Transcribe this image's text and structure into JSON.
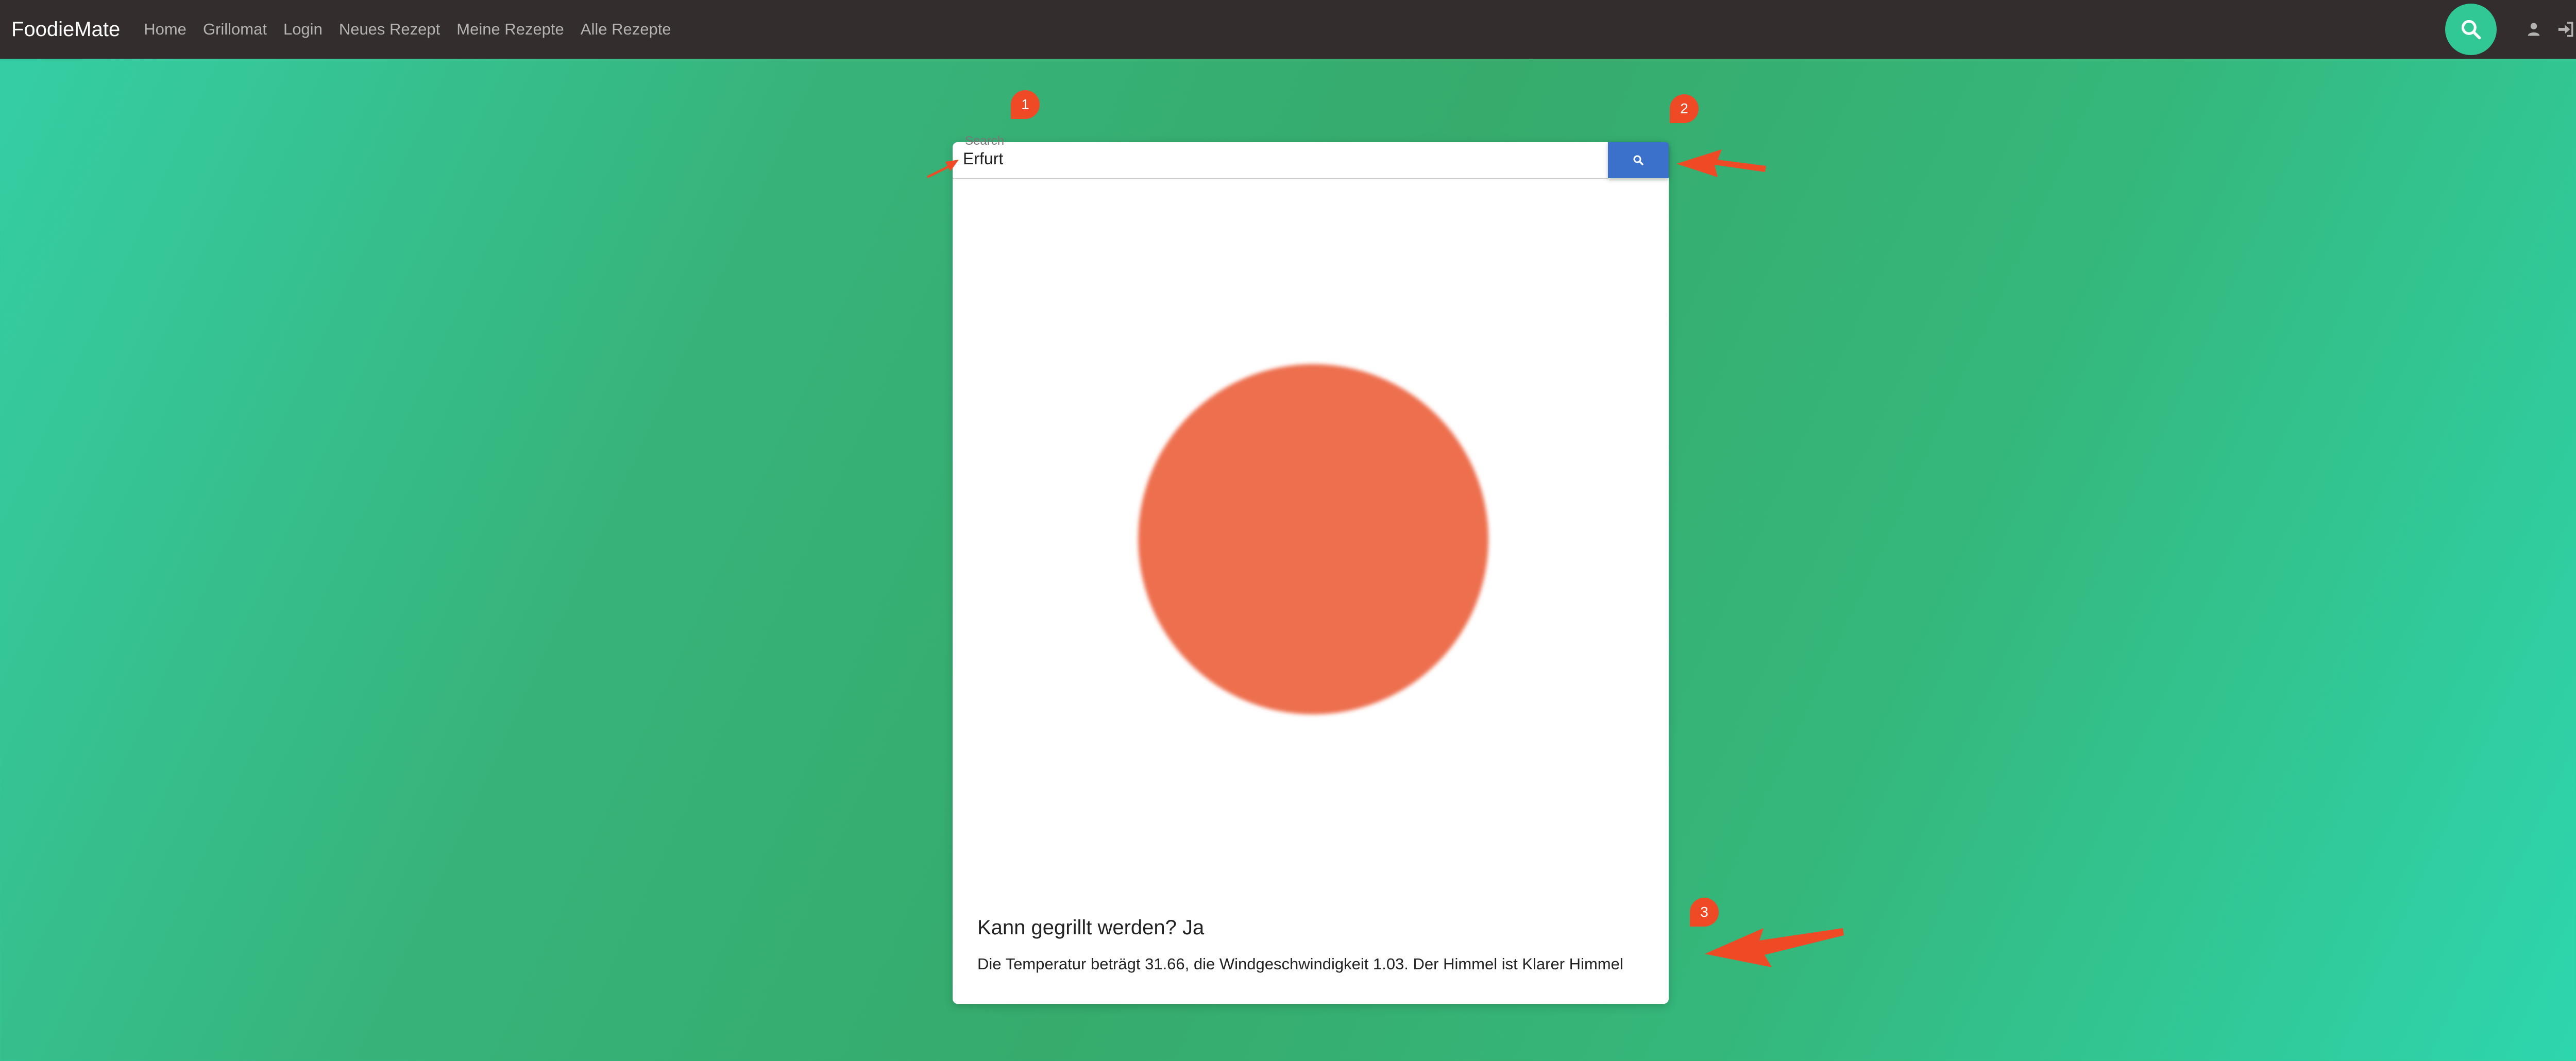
{
  "navbar": {
    "brand": "FoodieMate",
    "links": [
      "Home",
      "Grillomat",
      "Login",
      "Neues Rezept",
      "Meine Rezepte",
      "Alle Rezepte"
    ]
  },
  "search": {
    "label": "Search",
    "value": "Erfurt"
  },
  "result": {
    "title": "Kann gegrillt werden? Ja",
    "details": "Die Temperatur beträgt 31.66, die Windgeschwindigkeit 1.03. Der Himmel ist Klarer Himmel"
  },
  "annotations": [
    "1",
    "2",
    "3"
  ],
  "colors": {
    "navbar": "#332d2d",
    "search_button": "#3b71ca",
    "status_circle": "#ed6f4e",
    "annotation": "#ee4a26"
  },
  "icons": [
    "search-icon",
    "user-icon",
    "sign-in-icon",
    "sign-out-icon"
  ]
}
